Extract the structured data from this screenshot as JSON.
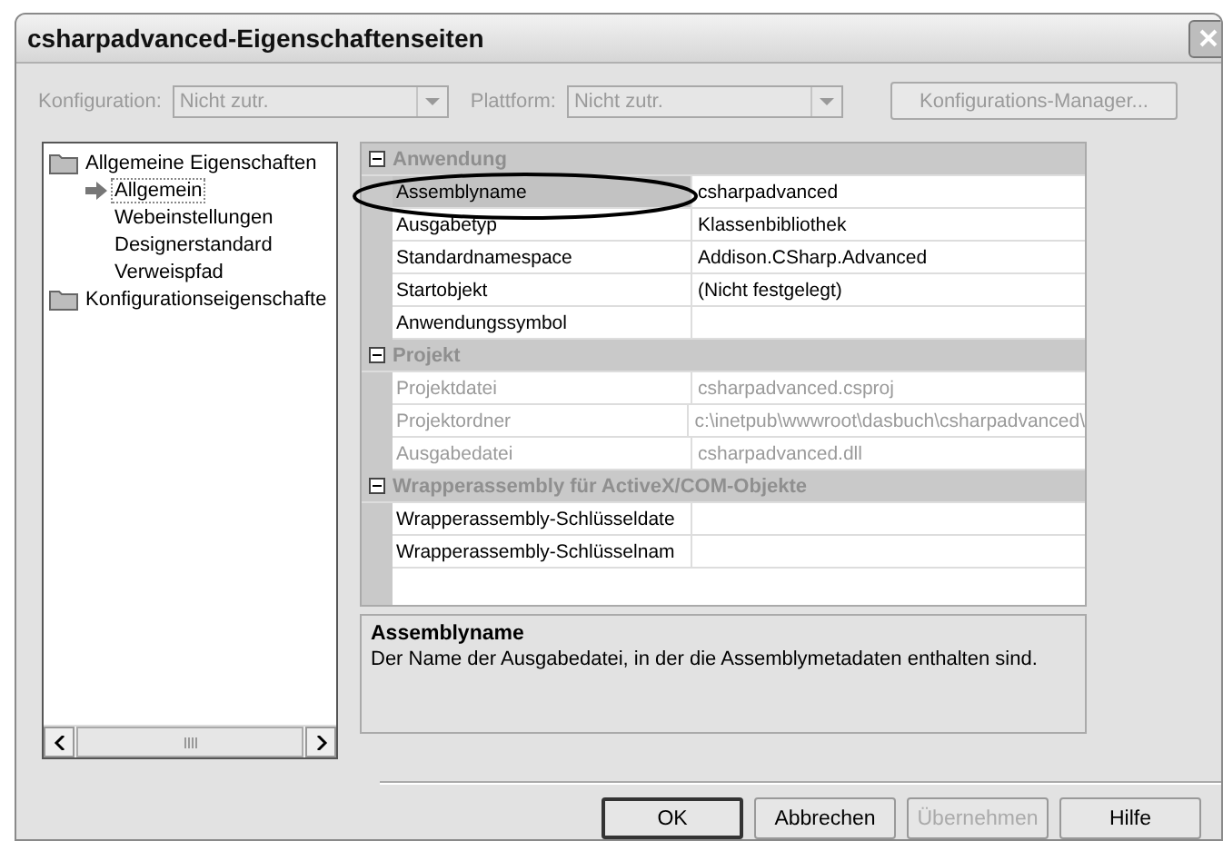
{
  "window": {
    "title": "csharpadvanced-Eigenschaftenseiten"
  },
  "toolbar": {
    "configuration": {
      "label": "Konfiguration:",
      "value": "Nicht zutr.",
      "disabled": true
    },
    "platform": {
      "label": "Plattform:",
      "value": "Nicht zutr.",
      "disabled": true
    },
    "manager_button": {
      "label": "Konfigurations-Manager...",
      "disabled": true
    }
  },
  "tree": [
    {
      "label": "Allgemeine Eigenschaften",
      "children": [
        {
          "label": "Allgemein",
          "selected": true
        },
        {
          "label": "Webeinstellungen",
          "selected": false
        },
        {
          "label": "Designerstandard",
          "selected": false
        },
        {
          "label": "Verweispfad",
          "selected": false
        }
      ]
    },
    {
      "label": "Konfigurationseigenschafte"
    }
  ],
  "grid": [
    {
      "category": "Anwendung",
      "expanded": true,
      "rows": [
        {
          "name": "Assemblyname",
          "value": "csharpadvanced",
          "selected": true,
          "disabled": false
        },
        {
          "name": "Ausgabetyp",
          "value": "Klassenbibliothek",
          "selected": false,
          "disabled": false
        },
        {
          "name": "Standardnamespace",
          "value": "Addison.CSharp.Advanced",
          "selected": false,
          "disabled": false
        },
        {
          "name": "Startobjekt",
          "value": "(Nicht festgelegt)",
          "selected": false,
          "disabled": false
        },
        {
          "name": "Anwendungssymbol",
          "value": "",
          "selected": false,
          "disabled": false
        }
      ]
    },
    {
      "category": "Projekt",
      "expanded": true,
      "rows": [
        {
          "name": "Projektdatei",
          "value": "csharpadvanced.csproj",
          "selected": false,
          "disabled": true
        },
        {
          "name": "Projektordner",
          "value": "c:\\inetpub\\wwwroot\\dasbuch\\csharpadvanced\\",
          "selected": false,
          "disabled": true
        },
        {
          "name": "Ausgabedatei",
          "value": "csharpadvanced.dll",
          "selected": false,
          "disabled": true
        }
      ]
    },
    {
      "category": "Wrapperassembly für ActiveX/COM-Objekte",
      "expanded": true,
      "rows": [
        {
          "name": "Wrapperassembly-Schlüsseldate",
          "value": "",
          "selected": false,
          "disabled": false
        },
        {
          "name": "Wrapperassembly-Schlüsselnam",
          "value": "",
          "selected": false,
          "disabled": false
        }
      ]
    }
  ],
  "description": {
    "title": "Assemblyname",
    "text": "Der Name der Ausgabedatei, in der die Assemblymetadaten enthalten sind."
  },
  "buttons": [
    {
      "label": "OK",
      "default": true,
      "disabled": false
    },
    {
      "label": "Abbrechen",
      "default": false,
      "disabled": false
    },
    {
      "label": "Übernehmen",
      "default": false,
      "disabled": true
    },
    {
      "label": "Hilfe",
      "default": false,
      "disabled": false
    }
  ]
}
